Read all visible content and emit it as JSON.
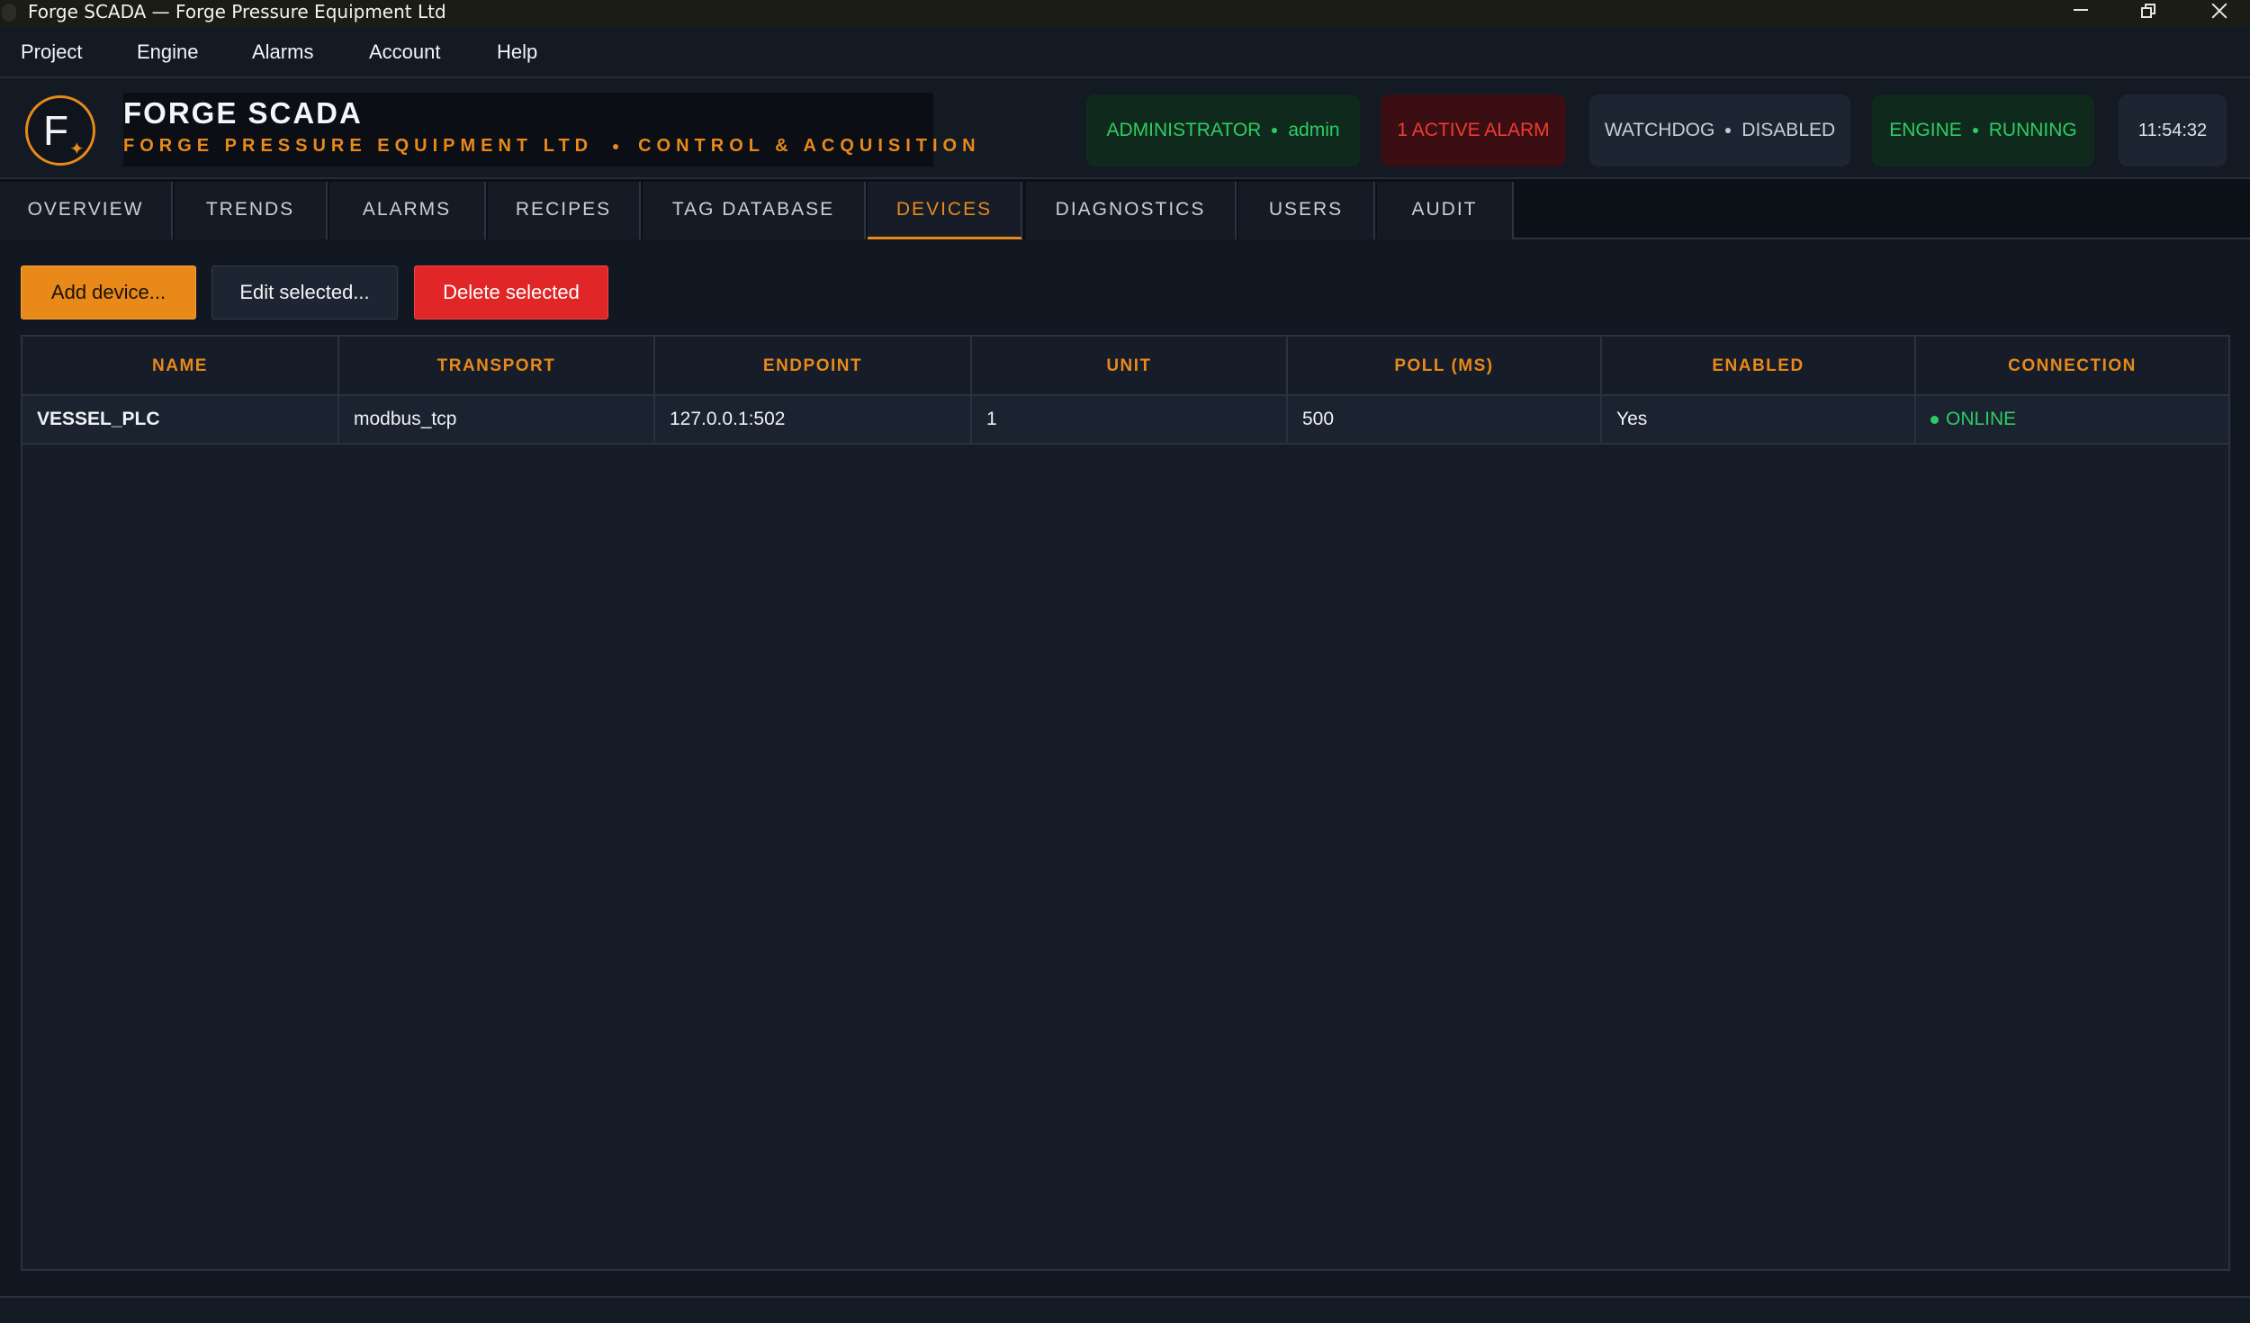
{
  "window": {
    "title": "Forge SCADA — Forge Pressure Equipment Ltd"
  },
  "menu": [
    "Project",
    "Engine",
    "Alarms",
    "Account",
    "Help"
  ],
  "brand": {
    "logo_letter": "F",
    "title": "FORGE SCADA",
    "subtitle_company": "FORGE PRESSURE EQUIPMENT LTD",
    "subtitle_tagline": "CONTROL & ACQUISITION"
  },
  "status": {
    "role": "ADMINISTRATOR",
    "user": "admin",
    "alarm": "1 ACTIVE ALARM",
    "watchdog_label": "WATCHDOG",
    "watchdog_state": "DISABLED",
    "engine_label": "ENGINE",
    "engine_state": "RUNNING",
    "clock": "11:54:32"
  },
  "tabs": [
    {
      "label": "OVERVIEW",
      "active": false
    },
    {
      "label": "TRENDS",
      "active": false
    },
    {
      "label": "ALARMS",
      "active": false
    },
    {
      "label": "RECIPES",
      "active": false
    },
    {
      "label": "TAG DATABASE",
      "active": false
    },
    {
      "label": "DEVICES",
      "active": true
    },
    {
      "label": "DIAGNOSTICS",
      "active": false
    },
    {
      "label": "USERS",
      "active": false
    },
    {
      "label": "AUDIT",
      "active": false
    }
  ],
  "actions": {
    "add": "Add device...",
    "edit": "Edit selected...",
    "delete": "Delete selected"
  },
  "table": {
    "columns": [
      "NAME",
      "TRANSPORT",
      "ENDPOINT",
      "UNIT",
      "POLL (MS)",
      "ENABLED",
      "CONNECTION"
    ],
    "rows": [
      [
        "VESSEL_PLC",
        "modbus_tcp",
        "127.0.0.1:502",
        "1",
        "500",
        "Yes",
        "ONLINE"
      ]
    ]
  },
  "colors": {
    "accent": "#e8891a",
    "ok": "#2fcc63",
    "alarm": "#f13a35",
    "danger": "#e02626"
  }
}
